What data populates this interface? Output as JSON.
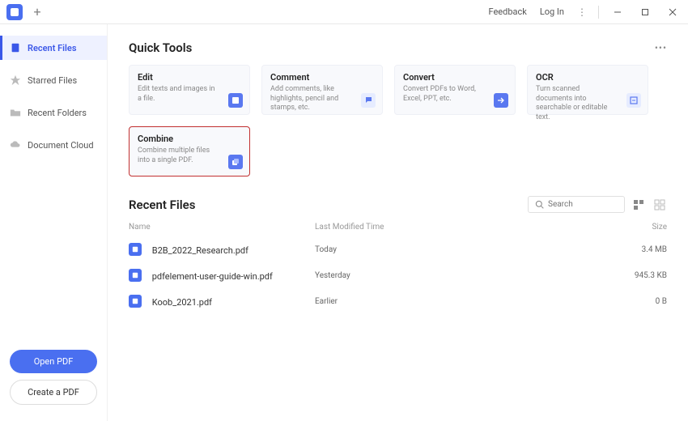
{
  "titlebar": {
    "feedback": "Feedback",
    "login": "Log In"
  },
  "sidebar": {
    "items": [
      {
        "label": "Recent Files",
        "active": true
      },
      {
        "label": "Starred Files",
        "active": false
      },
      {
        "label": "Recent Folders",
        "active": false
      },
      {
        "label": "Document Cloud",
        "active": false
      }
    ],
    "open_pdf": "Open PDF",
    "create_pdf": "Create a PDF"
  },
  "quick_tools": {
    "heading": "Quick Tools",
    "tools": [
      {
        "title": "Edit",
        "desc": "Edit texts and images in a file."
      },
      {
        "title": "Comment",
        "desc": "Add comments, like highlights, pencil and stamps, etc."
      },
      {
        "title": "Convert",
        "desc": "Convert PDFs to Word, Excel, PPT, etc."
      },
      {
        "title": "OCR",
        "desc": "Turn scanned documents into searchable or editable text."
      },
      {
        "title": "Combine",
        "desc": "Combine multiple files into a single PDF.",
        "highlighted": true
      }
    ]
  },
  "recent": {
    "heading": "Recent Files",
    "search_placeholder": "Search",
    "columns": {
      "name": "Name",
      "time": "Last Modified Time",
      "size": "Size"
    },
    "rows": [
      {
        "name": "B2B_2022_Research.pdf",
        "time": "Today",
        "size": "3.4 MB"
      },
      {
        "name": "pdfelement-user-guide-win.pdf",
        "time": "Yesterday",
        "size": "945.3 KB"
      },
      {
        "name": "Koob_2021.pdf",
        "time": "Earlier",
        "size": "0 B"
      }
    ]
  }
}
